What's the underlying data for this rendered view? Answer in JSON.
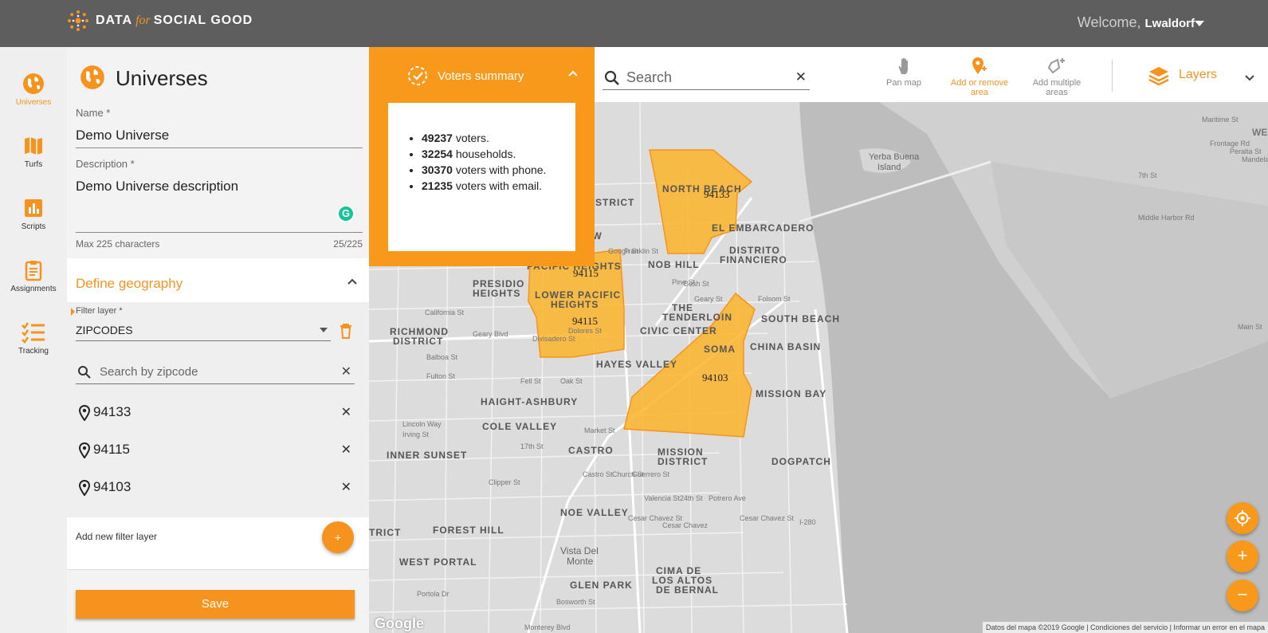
{
  "header": {
    "brand_data": "DATA",
    "brand_for": "for",
    "brand_rest": "SOCIAL GOOD",
    "welcome": "Welcome,",
    "username": "Lwaldorf"
  },
  "nav": {
    "items": [
      {
        "label": "Universes",
        "icon": "globe-icon",
        "active": true
      },
      {
        "label": "Turfs",
        "icon": "map-icon",
        "active": false
      },
      {
        "label": "Scripts",
        "icon": "bar-chart-icon",
        "active": false
      },
      {
        "label": "Assignments",
        "icon": "clipboard-icon",
        "active": false
      },
      {
        "label": "Tracking",
        "icon": "checklist-icon",
        "active": false
      }
    ]
  },
  "universe": {
    "title": "Universes",
    "name_label": "Name *",
    "name_value": "Demo Universe",
    "description_label": "Description *",
    "description_value": "Demo Universe description",
    "hint": "Max 225 characters",
    "counter": "25/225"
  },
  "geography": {
    "title": "Define geography",
    "filter_label": "Filter layer *",
    "filter_value": "ZIPCODES",
    "search_placeholder": "Search by zipcode",
    "zipcodes": [
      "94133",
      "94115",
      "94103"
    ],
    "add_layer_label": "Add new filter layer",
    "add_button": "+",
    "save_label": "Save"
  },
  "summary": {
    "title": "Voters summary",
    "items": [
      {
        "value": "49237",
        "text": " voters."
      },
      {
        "value": "32254",
        "text": " households."
      },
      {
        "value": "30370",
        "text": " voters with phone."
      },
      {
        "value": "21235",
        "text": " voters with email."
      }
    ]
  },
  "toolbar": {
    "search_placeholder": "Search",
    "pan_map": "Pan map",
    "add_remove_1": "Add or remove",
    "add_remove_2": "area",
    "add_multiple_1": "Add multiple",
    "add_multiple_2": "areas",
    "layers": "Layers"
  },
  "map": {
    "neighborhoods": [
      "NORTH BEACH",
      "EL EMBARCADERO",
      "DISTRITO",
      "FINANCIERO",
      "NOB HILL",
      "PACIFIC HEIGHTS",
      "PRESIDIO",
      "HEIGHTS",
      "LOWER PACIFIC",
      "HEIGHTS",
      "THE",
      "TENDERLOIN",
      "CIVIC CENTER",
      "SOMA",
      "SOUTH BEACH",
      "CHINA BASIN",
      "RICHMOND",
      "DISTRICT",
      "HAYES VALLEY",
      "HAIGHT-ASHBURY",
      "COLE VALLEY",
      "MISSION BAY",
      "INNER SUNSET",
      "CASTRO",
      "MISSION",
      "DISTRICT",
      "DOGPATCH",
      "NOE VALLEY",
      "FOREST HILL",
      "WEST PORTAL",
      "Vista Del",
      "Monte",
      "GLEN PARK",
      "CIMA DE",
      "LOS ALTOS",
      "DE BERNAL",
      "TRICT",
      "DISTRICT",
      "OW",
      "Yerba Buena",
      "Island"
    ],
    "zip_labels": [
      "94133",
      "94115",
      "94115",
      "94103"
    ],
    "streets": [
      "California St",
      "Geary Blvd",
      "Balboa St",
      "Fulton St",
      "Fell St",
      "Oak St",
      "Lincoln Way",
      "Irving St",
      "17th St",
      "Market St",
      "Castro St",
      "Church St",
      "Guerrero St",
      "Valencia St",
      "24th St",
      "Cesar Chavez",
      "Potrero Ave",
      "Folsom St",
      "Pine St",
      "Bush St",
      "Geary St",
      "Franklin St",
      "Gough St",
      "Divisadero St",
      "Clipper St",
      "Monterey Blvd",
      "Bosworth St",
      "Portola Dr",
      "Maritime St",
      "7th St",
      "Middle Harbor Rd",
      "Frontage Rd",
      "Peralta St",
      "Mandela Pkwy",
      "Main St",
      "Cesar Chavez St",
      "I-280",
      "Cesar Chavez St",
      "Dolores St",
      "WES"
    ],
    "google": "Google",
    "attribution": "Datos del mapa ©2019 Google | Condiciones del servicio | Informar un error en el mapa"
  },
  "fabs": {
    "locate": "locate-icon",
    "zoom_in": "+",
    "zoom_out": "−"
  },
  "colors": {
    "accent": "#f6931f",
    "topbar": "#5e5e5e",
    "polygon_fill": "#fbb42a"
  }
}
